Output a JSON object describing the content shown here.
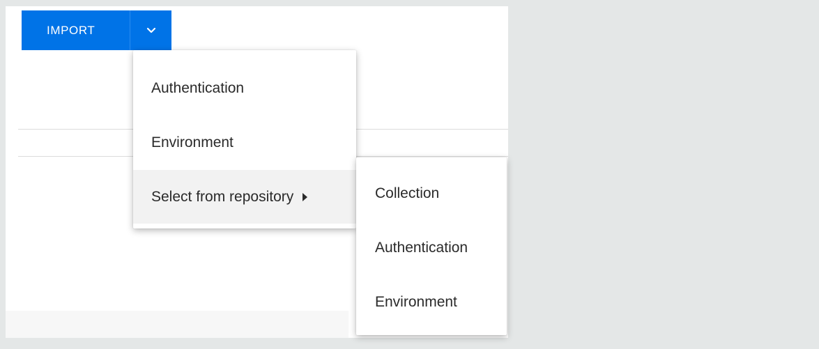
{
  "import_button": {
    "label": "IMPORT",
    "dropdown_icon": "chevron-down-icon",
    "color": "#0073e7"
  },
  "import_menu": {
    "items": [
      {
        "label": "Authentication"
      },
      {
        "label": "Environment"
      },
      {
        "label": "Select from repository",
        "submenu_icon": "caret-right-icon"
      }
    ]
  },
  "repository_submenu": {
    "items": [
      {
        "label": "Collection"
      },
      {
        "label": "Authentication"
      },
      {
        "label": "Environment"
      }
    ]
  }
}
